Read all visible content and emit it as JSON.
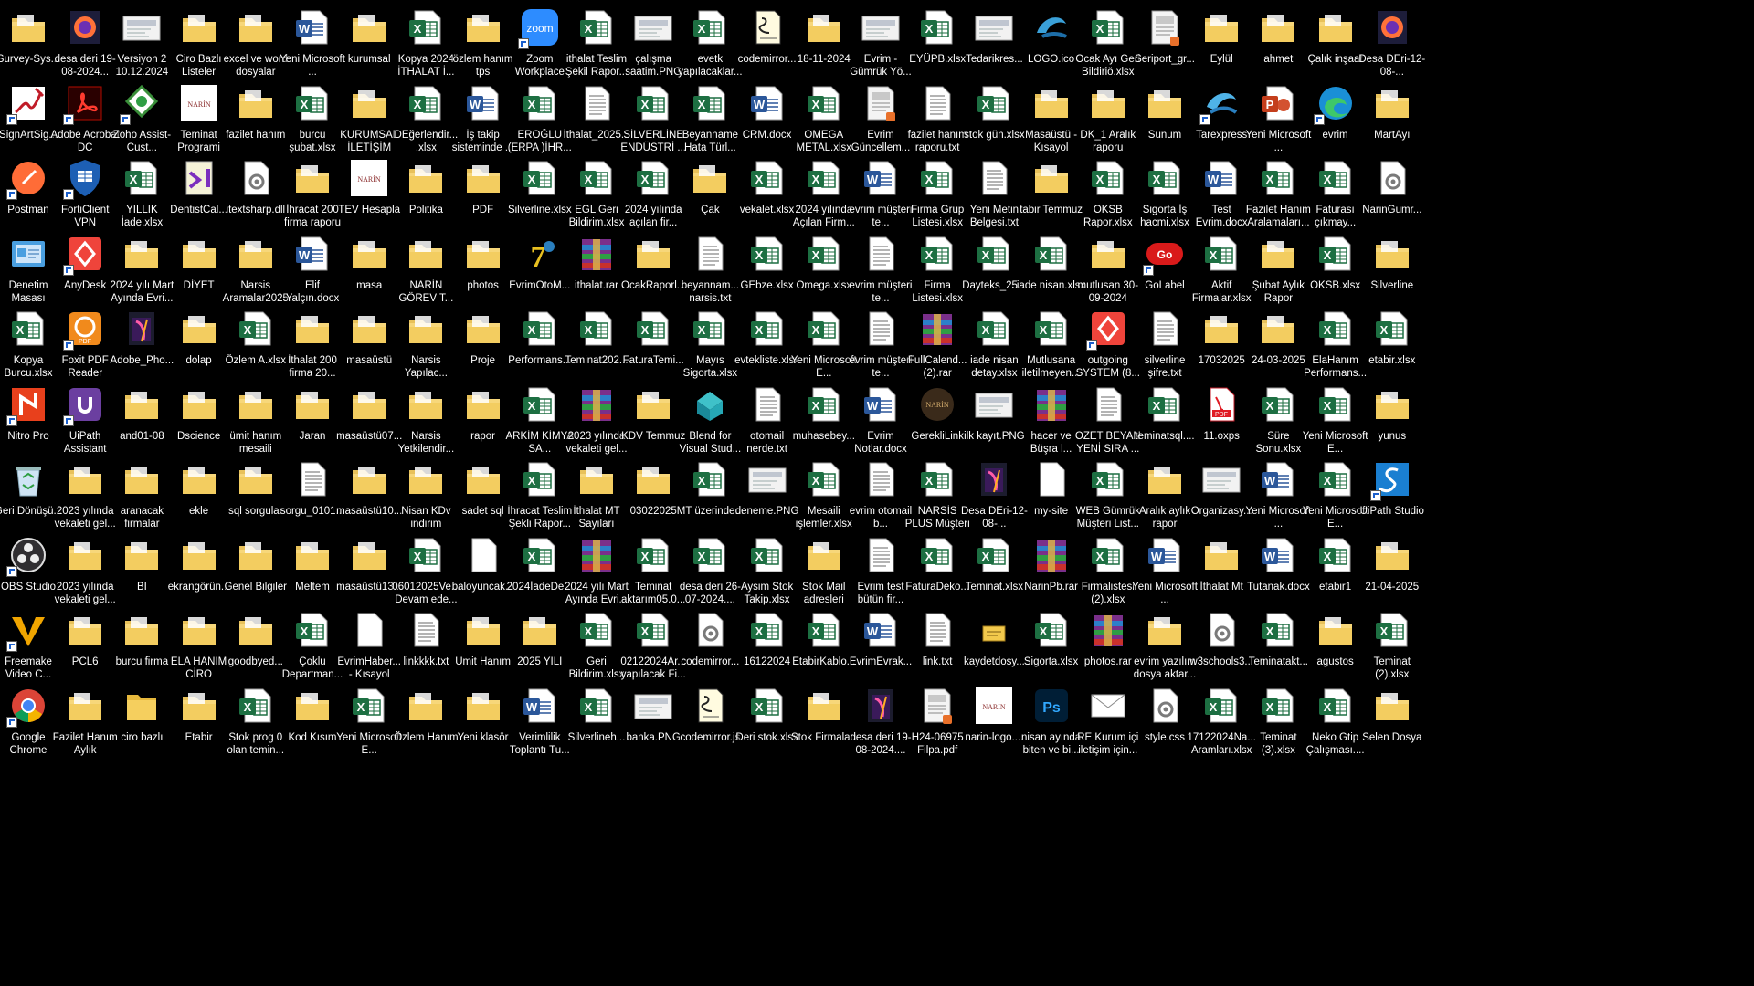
{
  "desktop": {
    "columns": 25,
    "icons": [
      [
        "Survey-Sys...",
        "folder-icon"
      ],
      [
        "desa deri 19-08-2024...",
        "firefox-icon"
      ],
      [
        "Versiyon 2 10.12.2024 Ş...",
        "image-thumb-icon"
      ],
      [
        "Ciro Bazlı Listeler",
        "folder-icon"
      ],
      [
        "excel ve word dosyalar",
        "folder-icon"
      ],
      [
        "Yeni Microsoft ...",
        "word-icon"
      ],
      [
        "kurumsal",
        "folder-icon"
      ],
      [
        "Kopya 2024 İTHALAT İ...",
        "excel-icon"
      ],
      [
        "özlem hanım tps",
        "folder-icon"
      ],
      [
        "Zoom Workplace",
        "zoom-icon"
      ],
      [
        "ithalat Teslim Şekil Rapor...",
        "excel-icon"
      ],
      [
        "çalışma saatim.PNG",
        "image-thumb-icon"
      ],
      [
        "evetk yapılacaklar...",
        "excel-icon"
      ],
      [
        "codemirror...",
        "script-icon"
      ],
      [
        "18-11-2024",
        "folder-icon"
      ],
      [
        "Evrim - Gümrük Yö...",
        "image-thumb-icon"
      ],
      [
        "EYÜPB.xlsx",
        "excel-icon"
      ],
      [
        "Tedarikres...",
        "image-thumb-icon"
      ],
      [
        "LOGO.ico",
        "logo-ico-icon"
      ],
      [
        "Ocak Ayı Geri Bildiriö.xlsx",
        "excel-icon"
      ],
      [
        "Seriport_gr...",
        "document-icon"
      ],
      [
        "Eylül",
        "folder-icon"
      ],
      [
        "ahmet",
        "folder-icon"
      ],
      [
        "Çalık inşaat",
        "folder-icon"
      ],
      [
        "Desa DEri-12-08-...",
        "firefox-icon"
      ],
      [
        "SignArtSig...",
        "signature-icon"
      ],
      [
        "Adobe Acrobat DC",
        "acrobat-icon"
      ],
      [
        "Zoho Assist-Cust...",
        "zoho-icon"
      ],
      [
        "Teminat Programi",
        "narin-logo-icon"
      ],
      [
        "fazilet hanım",
        "folder-icon"
      ],
      [
        "burcu şubat.xlsx",
        "excel-icon"
      ],
      [
        "KURUMSAL İLETİŞİM",
        "folder-icon"
      ],
      [
        "DEğerlendir... .xlsx",
        "excel-icon"
      ],
      [
        "İş takip sisteminde ...",
        "word-icon"
      ],
      [
        "EROĞLU (ERPA )İHR...",
        "excel-icon"
      ],
      [
        "İthalat_2025...",
        "text-icon"
      ],
      [
        "SİLVERLİNE ENDÜSTRİ ...",
        "excel-icon"
      ],
      [
        "Beyanname Hata Türl...",
        "excel-icon"
      ],
      [
        "CRM.docx",
        "word-icon"
      ],
      [
        "OMEGA METAL.xlsx",
        "excel-icon"
      ],
      [
        "Evrim Güncellem...",
        "document-icon"
      ],
      [
        "fazilet hanım raporu.txt",
        "text-icon"
      ],
      [
        "stok gün.xlsx",
        "excel-icon"
      ],
      [
        "Masaüstü - Kısayol",
        "folder-icon"
      ],
      [
        "DK_1 Aralık raporu",
        "folder-icon"
      ],
      [
        "Sunum",
        "folder-icon"
      ],
      [
        "Tarexpress",
        "tarexpress-icon"
      ],
      [
        "Yeni Microsoft ...",
        "powerpoint-icon"
      ],
      [
        "evrim",
        "edge-icon"
      ],
      [
        "MartAyı",
        "folder-icon"
      ],
      [
        "Postman",
        "postman-icon"
      ],
      [
        "FortiClient VPN",
        "forticlient-icon"
      ],
      [
        "YILLIK İade.xlsx",
        "excel-icon"
      ],
      [
        "DentistCal...",
        "visual-studio-icon"
      ],
      [
        "itextsharp.dll",
        "gear-file-icon"
      ],
      [
        "İhracat 200 firma raporu",
        "folder-icon"
      ],
      [
        "TEV Hesapla",
        "narin-logo-icon"
      ],
      [
        "Politika",
        "folder-icon"
      ],
      [
        "PDF",
        "folder-icon"
      ],
      [
        "Silverline.xlsx",
        "excel-icon"
      ],
      [
        "EGL Geri Bildirim.xlsx",
        "excel-icon"
      ],
      [
        "2024 yılında açılan fir...",
        "excel-icon"
      ],
      [
        "Çak",
        "folder-icon"
      ],
      [
        "vekalet.xlsx",
        "excel-icon"
      ],
      [
        "2024 yılında Açılan Firm...",
        "excel-icon"
      ],
      [
        "evrim müşteri te...",
        "word-icon"
      ],
      [
        "Firma Grup Listesi.xlsx",
        "excel-icon"
      ],
      [
        "Yeni Metin Belgesi.txt",
        "text-icon"
      ],
      [
        "tabir Temmuz",
        "folder-icon"
      ],
      [
        "OKSB Rapor.xlsx",
        "excel-icon"
      ],
      [
        "Sigorta İş hacmi.xlsx",
        "excel-icon"
      ],
      [
        "Test Evrim.docx",
        "word-icon"
      ],
      [
        "Fazilet Hanım Aralamaları...",
        "excel-icon"
      ],
      [
        "Faturası çıkmay...",
        "excel-icon"
      ],
      [
        "NarinGumr...",
        "gear-file-icon"
      ],
      [
        "Denetim Masası",
        "control-panel-icon"
      ],
      [
        "AnyDesk",
        "anydesk-icon"
      ],
      [
        "2024 yılı Mart Ayında Evri...",
        "folder-icon"
      ],
      [
        "DİYET",
        "folder-icon"
      ],
      [
        "Narsis Aramalar2025",
        "folder-icon"
      ],
      [
        "Elif Yalçın.docx",
        "word-icon"
      ],
      [
        "masa",
        "folder-icon"
      ],
      [
        "NARİN GÖREV T...",
        "folder-icon"
      ],
      [
        "photos",
        "folder-icon"
      ],
      [
        "EvrimOtoM...",
        "evrimoto-icon"
      ],
      [
        "ithalat.rar",
        "winrar-icon"
      ],
      [
        "OcakRaporl...",
        "folder-icon"
      ],
      [
        "beyannam... narsis.txt",
        "text-icon"
      ],
      [
        "GEbze.xlsx",
        "excel-icon"
      ],
      [
        "Omega.xlsx",
        "excel-icon"
      ],
      [
        "evrim müşteri te...",
        "text-icon"
      ],
      [
        "Firma Listesi.xlsx",
        "excel-icon"
      ],
      [
        "Dayteks_25...",
        "excel-icon"
      ],
      [
        "iade nisan.xlsx",
        "excel-icon"
      ],
      [
        "mutlusan 30-09-2024",
        "folder-icon"
      ],
      [
        "GoLabel",
        "golabel-icon"
      ],
      [
        "Aktif Firmalar.xlsx",
        "excel-icon"
      ],
      [
        "Şubat Aylık Rapor",
        "folder-icon"
      ],
      [
        "OKSB.xlsx",
        "excel-icon"
      ],
      [
        "Silverline",
        "folder-icon"
      ],
      [
        "Kopya Burcu.xlsx",
        "excel-icon"
      ],
      [
        "Foxit PDF Reader",
        "foxit-icon"
      ],
      [
        "Adobe_Pho...",
        "photoshop-installer-icon"
      ],
      [
        "dolap",
        "folder-icon"
      ],
      [
        "Özlem A.xlsx",
        "excel-icon"
      ],
      [
        "İthalat 200 firma 20...",
        "folder-icon"
      ],
      [
        "masaüstü",
        "folder-icon"
      ],
      [
        "Narsis Yapılac...",
        "folder-icon"
      ],
      [
        "Proje",
        "folder-icon"
      ],
      [
        "Performans...",
        "excel-icon"
      ],
      [
        "Teminat202...",
        "excel-icon"
      ],
      [
        "FaturaTemi...",
        "excel-icon"
      ],
      [
        "Mayıs Sigorta.xlsx",
        "excel-icon"
      ],
      [
        "evtekliste.xlsx",
        "excel-icon"
      ],
      [
        "Yeni Microsoft E...",
        "excel-icon"
      ],
      [
        "evrim müşteri te...",
        "text-icon"
      ],
      [
        "FullCalend... (2).rar",
        "winrar-icon"
      ],
      [
        "iade nisan detay.xlsx",
        "excel-icon"
      ],
      [
        "Mutlusana iletilmeyen...",
        "excel-icon"
      ],
      [
        "outgoing SYSTEM (8...",
        "anydesk-icon"
      ],
      [
        "silverline şifre.txt",
        "text-icon"
      ],
      [
        "17032025",
        "folder-icon"
      ],
      [
        "24-03-2025",
        "folder-icon"
      ],
      [
        "ElaHanım Performans...",
        "excel-icon"
      ],
      [
        "etabir.xlsx",
        "excel-icon"
      ],
      [
        "Nitro Pro",
        "nitro-icon"
      ],
      [
        "UiPath Assistant",
        "uipath-assistant-icon"
      ],
      [
        "and01-08",
        "folder-icon"
      ],
      [
        "Dscience",
        "folder-icon"
      ],
      [
        "ümit hanım mesaili",
        "folder-icon"
      ],
      [
        "Jaran",
        "folder-icon"
      ],
      [
        "masaüstü07...",
        "folder-icon"
      ],
      [
        "Narsis Yetkilendir...",
        "folder-icon"
      ],
      [
        "rapor",
        "folder-icon"
      ],
      [
        "ARKİM KİMYA SA...",
        "excel-icon"
      ],
      [
        "2023 yılında vekaleti gel...",
        "winrar-icon"
      ],
      [
        "KDV Temmuz",
        "folder-icon"
      ],
      [
        "Blend for Visual Stud...",
        "blend-icon"
      ],
      [
        "otomail nerde.txt",
        "text-icon"
      ],
      [
        "muhasebey...",
        "excel-icon"
      ],
      [
        "Evrim Notlar.docx",
        "word-icon"
      ],
      [
        "GerekliLink",
        "narin-dark-icon"
      ],
      [
        "ilk kayıt.PNG",
        "image-thumb-icon"
      ],
      [
        "hacer ve Büşra l...",
        "winrar-icon"
      ],
      [
        "OZET BEYAN YENİ SIRA ...",
        "text-icon"
      ],
      [
        "teminatsql....",
        "excel-icon"
      ],
      [
        "11.oxps",
        "pdf-icon"
      ],
      [
        "Süre Sonu.xlsx",
        "excel-icon"
      ],
      [
        "Yeni Microsoft E...",
        "excel-icon"
      ],
      [
        "yunus",
        "folder-icon"
      ],
      [
        "Geri Dönüşü...",
        "recycle-bin-icon"
      ],
      [
        "2023 yılında vekaleti gel...",
        "folder-icon"
      ],
      [
        "aranacak firmalar",
        "folder-icon"
      ],
      [
        "ekle",
        "folder-icon"
      ],
      [
        "sql sorgular",
        "folder-icon"
      ],
      [
        "sorgu_0101...",
        "text-icon"
      ],
      [
        "masaüstü10...",
        "folder-icon"
      ],
      [
        "Nisan KDv indirim",
        "folder-icon"
      ],
      [
        "sadet sql",
        "folder-icon"
      ],
      [
        "İhracat Teslim Şekli Rapor...",
        "excel-icon"
      ],
      [
        "İthalat MT Sayıları",
        "folder-icon"
      ],
      [
        "03022025",
        "folder-icon"
      ],
      [
        "MT üzerinde...",
        "excel-icon"
      ],
      [
        "deneme.PNG",
        "image-thumb-icon"
      ],
      [
        "Mesaili işlemler.xlsx",
        "excel-icon"
      ],
      [
        "evrim otomail b...",
        "text-icon"
      ],
      [
        "NARSİS PLUS Müşteri Lis...",
        "excel-icon"
      ],
      [
        "Desa DEri-12-08-...",
        "photoshop-installer-icon"
      ],
      [
        "my-site",
        "blank-file-icon"
      ],
      [
        "WEB Gümrük Müşteri List...",
        "excel-icon"
      ],
      [
        "Aralık aylık rapor",
        "folder-icon"
      ],
      [
        "Organizasy...",
        "image-thumb-icon"
      ],
      [
        "Yeni Microsoft ...",
        "word-icon"
      ],
      [
        "Yeni Microsoft E...",
        "excel-icon"
      ],
      [
        "UiPath Studio",
        "uipath-studio-icon"
      ],
      [
        "OBS Studio",
        "obs-icon"
      ],
      [
        "2023 yılında vekaleti gel...",
        "folder-icon"
      ],
      [
        "BI",
        "folder-icon"
      ],
      [
        "ekrangörün...",
        "folder-icon"
      ],
      [
        "Genel Bilgiler",
        "folder-icon"
      ],
      [
        "Meltem",
        "folder-icon"
      ],
      [
        "masaüstü13...",
        "folder-icon"
      ],
      [
        "06012025Ve... Devam ede...",
        "excel-icon"
      ],
      [
        "baloyuncak...",
        "blank-file-icon"
      ],
      [
        "2024İadeDe...",
        "excel-icon"
      ],
      [
        "2024 yılı Mart Ayında Evri...",
        "winrar-icon"
      ],
      [
        "Teminat aktarım05.0...",
        "excel-icon"
      ],
      [
        "desa deri 26-07-2024....",
        "excel-icon"
      ],
      [
        "Aysim Stok Takip.xlsx",
        "excel-icon"
      ],
      [
        "Stok Mail adresleri",
        "folder-icon"
      ],
      [
        "Evrim test bütün fir...",
        "text-icon"
      ],
      [
        "FaturaDeko...",
        "excel-icon"
      ],
      [
        "Teminat.xlsx",
        "excel-icon"
      ],
      [
        "NarinPb.rar",
        "winrar-icon"
      ],
      [
        "Firmalistesi (2).xlsx",
        "excel-icon"
      ],
      [
        "Yeni Microsoft ...",
        "word-icon"
      ],
      [
        "İthalat Mt",
        "folder-icon"
      ],
      [
        "Tutanak.docx",
        "word-icon"
      ],
      [
        "etabir1",
        "excel-icon"
      ],
      [
        "21-04-2025",
        "folder-icon"
      ],
      [
        "Freemake Video C...",
        "freemake-icon"
      ],
      [
        "PCL6",
        "folder-icon"
      ],
      [
        "burcu firma",
        "folder-icon"
      ],
      [
        "ELA HANIM CİRO",
        "folder-icon"
      ],
      [
        "goodbyed...",
        "folder-icon"
      ],
      [
        "Çoklu Departman...",
        "excel-icon"
      ],
      [
        "EvrimHaber... - Kısayol",
        "blank-file-icon"
      ],
      [
        "linkkkk.txt",
        "text-icon"
      ],
      [
        "Ümit Hanım",
        "folder-icon"
      ],
      [
        "2025 YILI",
        "folder-icon"
      ],
      [
        "Geri Bildirim.xlsx",
        "excel-icon"
      ],
      [
        "02122024Ar... yapılacak Fi...",
        "excel-icon"
      ],
      [
        "codemirror...",
        "gear-file-icon"
      ],
      [
        "16122024",
        "excel-icon"
      ],
      [
        "EtabirKablo...",
        "excel-icon"
      ],
      [
        "EvrimEvrak...",
        "word-icon"
      ],
      [
        "link.txt",
        "text-icon"
      ],
      [
        "kaydetdosy...",
        "kaydet-icon"
      ],
      [
        "Sigorta.xlsx",
        "excel-icon"
      ],
      [
        "photos.rar",
        "winrar-icon"
      ],
      [
        "evrim yazılım dosya aktar...",
        "folder-icon"
      ],
      [
        "w3schools3...",
        "gear-file-icon"
      ],
      [
        "Teminatakt...",
        "excel-icon"
      ],
      [
        "agustos",
        "folder-icon"
      ],
      [
        "Teminat (2).xlsx",
        "excel-icon"
      ],
      [
        "Google Chrome",
        "chrome-icon"
      ],
      [
        "Fazilet Hanım Aylık",
        "folder-icon"
      ],
      [
        "ciro bazlı",
        "folder-plain-icon"
      ],
      [
        "Etabir",
        "folder-icon"
      ],
      [
        "Stok prog 0 olan temin...",
        "excel-icon"
      ],
      [
        "Kod Kısım",
        "folder-icon"
      ],
      [
        "Yeni Microsoft E...",
        "excel-icon"
      ],
      [
        "Özlem Hanım",
        "folder-icon"
      ],
      [
        "Yeni klasör",
        "folder-icon"
      ],
      [
        "Verimlilik Toplantı Tu...",
        "word-icon"
      ],
      [
        "Silverlineh...",
        "excel-icon"
      ],
      [
        "banka.PNG",
        "image-thumb-icon"
      ],
      [
        "codemirror.js",
        "script-icon"
      ],
      [
        "Deri stok.xlsx",
        "excel-icon"
      ],
      [
        "Stok Firmaları",
        "folder-icon"
      ],
      [
        "desa deri 19-08-2024....",
        "photoshop-installer-icon"
      ],
      [
        "H24-06975 Filpa.pdf",
        "document-icon"
      ],
      [
        "narin-logo....",
        "narin-logo-icon"
      ],
      [
        "nisan ayında biten ve bi...",
        "photoshop-icon"
      ],
      [
        "RE Kurum içi iletişim için...",
        "mail-icon"
      ],
      [
        "style.css",
        "gear-file-icon"
      ],
      [
        "17122024Na... Aramları.xlsx",
        "excel-icon"
      ],
      [
        "Teminat (3).xlsx",
        "excel-icon"
      ],
      [
        "Neko Gtip Çalışması....",
        "excel-icon"
      ],
      [
        "Selen Dosya",
        "folder-icon"
      ]
    ]
  }
}
